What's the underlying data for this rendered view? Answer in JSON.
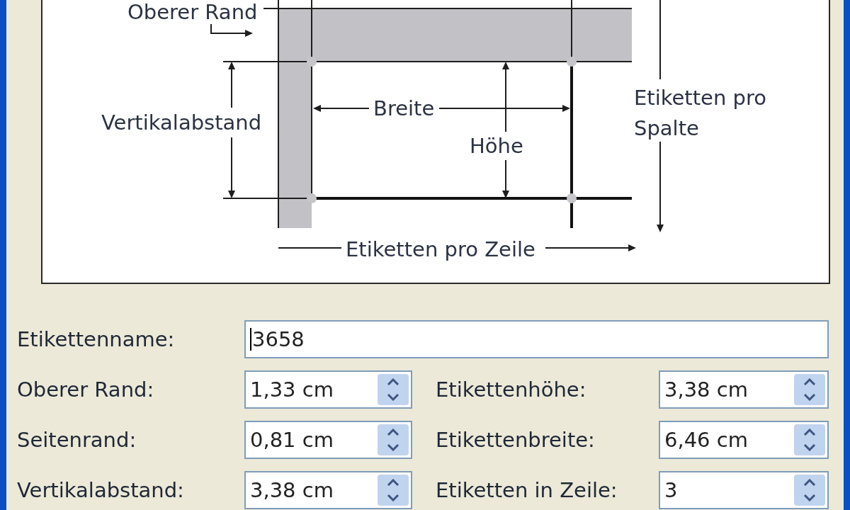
{
  "diagram": {
    "labels": [
      {
        "kind": "top_margin",
        "text": "Oberer Rand"
      },
      {
        "kind": "vertical_pitch",
        "text": "Vertikalabstand"
      },
      {
        "kind": "width",
        "text": "Breite"
      },
      {
        "kind": "height",
        "text": "Höhe"
      },
      {
        "kind": "per_column",
        "text": "Etiketten pro Spalte"
      },
      {
        "kind": "per_row",
        "text": "Etiketten pro Zeile"
      }
    ]
  },
  "name_field": {
    "label": "Etikettenname:",
    "value": "3658",
    "focused": true
  },
  "fields": [
    {
      "label": "Oberer Rand:",
      "value": "1,33 cm"
    },
    {
      "label": "Etikettenhöhe:",
      "value": "3,38 cm"
    },
    {
      "label": "Seitenrand:",
      "value": "0,81 cm"
    },
    {
      "label": "Etikettenbreite:",
      "value": "6,46 cm"
    },
    {
      "label": "Vertikalabstand:",
      "value": "3,38 cm"
    },
    {
      "label": "Etiketten in Zeile:",
      "value": "3"
    }
  ]
}
